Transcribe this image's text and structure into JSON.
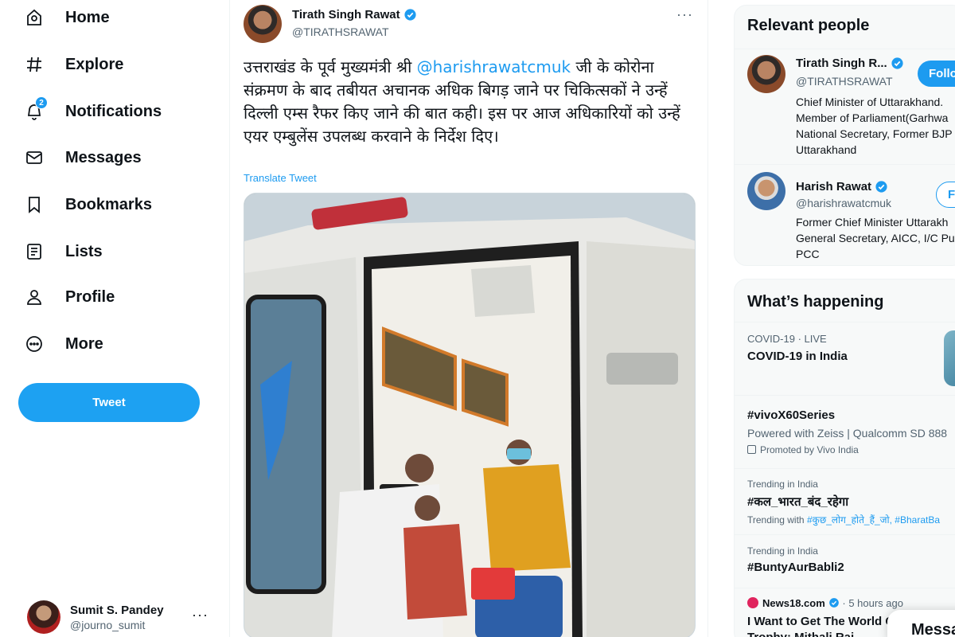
{
  "nav": {
    "items": [
      {
        "label": "Home",
        "icon": "home-icon"
      },
      {
        "label": "Explore",
        "icon": "hashtag-icon"
      },
      {
        "label": "Notifications",
        "icon": "bell-icon",
        "badge": "2"
      },
      {
        "label": "Messages",
        "icon": "envelope-icon"
      },
      {
        "label": "Bookmarks",
        "icon": "bookmark-icon"
      },
      {
        "label": "Lists",
        "icon": "list-icon"
      },
      {
        "label": "Profile",
        "icon": "person-icon"
      },
      {
        "label": "More",
        "icon": "more-circle-icon"
      }
    ],
    "tweet_button": "Tweet"
  },
  "account": {
    "name": "Sumit S. Pandey",
    "handle": "@journo_sumit",
    "more": "···"
  },
  "tweet": {
    "author_name": "Tirath Singh Rawat",
    "author_handle": "@TIRATHSRAWAT",
    "more": "···",
    "text_before": "उत्तराखंड के पूर्व मुख्यमंत्री श्री ",
    "mention": "@harishrawatcmuk",
    "text_after": " जी के कोरोना संक्रमण के बाद तबीयत अचानक अधिक बिगड़ जाने पर चिकित्सकों ने उन्हें दिल्ली एम्स रैफर किए जाने की बात कही। इस पर आज अधिकारियों को उन्हें एयर एम्बुलेंस उपलब्ध करवाने के निर्देश दिए।",
    "translate": "Translate Tweet"
  },
  "relevant_people": {
    "title": "Relevant people",
    "people": [
      {
        "name": "Tirath Singh R...",
        "handle": "@TIRATHSRAWAT",
        "follow": "Follow",
        "bio": [
          "Chief Minister of Uttarakhand.",
          "Member of Parliament(Garhwa",
          "National Secretary, Former BJP",
          "Uttarakhand"
        ]
      },
      {
        "name": "Harish Rawat",
        "handle": "@harishrawatcmuk",
        "follow": "Follow",
        "bio": [
          "Former Chief Minister Uttarakh",
          "General Secretary, AICC, I/C Pu",
          "PCC"
        ]
      }
    ]
  },
  "happening": {
    "title": "What’s happening",
    "trends": [
      {
        "meta": "COVID-19 · LIVE",
        "title": "COVID-19 in India"
      },
      {
        "title": "#vivoX60Series",
        "sub": "Powered with Zeiss | Qualcomm SD 888",
        "promo": "Promoted by Vivo India"
      },
      {
        "meta": "Trending in India",
        "title": "#कल_भारत_बंद_रहेगा",
        "sub_prefix": "Trending with ",
        "sub_link": "#कुछ_लोग_होते_हैं_जो, #BharatBa"
      },
      {
        "meta": "Trending in India",
        "title": "#BuntyAurBabli2"
      },
      {
        "source": "News18.com",
        "time": " · 5 hours ago",
        "title": "I Want to Get The World Cu",
        "sub_title": "Trophy: Mithali Raj"
      }
    ]
  },
  "messages_drawer": "Messa"
}
